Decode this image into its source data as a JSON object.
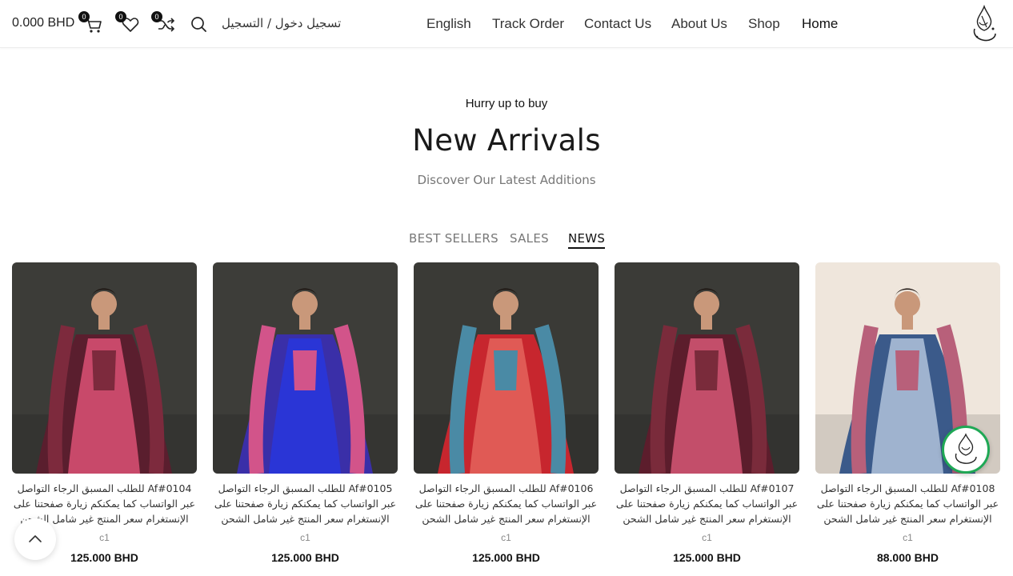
{
  "header": {
    "cart_total": "0.000 BHD",
    "cart_count": "0",
    "wishlist_count": "0",
    "compare_count": "0",
    "login_label": "تسجيل دخول / التسجيل",
    "nav": [
      "English",
      "Track Order",
      "Contact Us",
      "About Us",
      "Shop",
      "Home"
    ],
    "active_nav": "Home"
  },
  "hero": {
    "kicker": "Hurry up to buy",
    "title": "New Arrivals",
    "subtitle": "Discover Our Latest Additions"
  },
  "tabs": [
    "BEST SELLERS",
    "SALES",
    "NEWS"
  ],
  "active_tab": "NEWS",
  "products": [
    {
      "desc": "Af#0104 للطلب المسبق الرجاء التواصل عبر الواتساب كما يمكنكم زيارة صفحتنا على الإنستغرام سعر المنتج غير شامل الشحن",
      "category": "c1",
      "price": "125.000 BHD",
      "palette": [
        "#5a1e2e",
        "#c8496a",
        "#7d2a3d"
      ],
      "bg": "#3c3c38"
    },
    {
      "desc": "Af#0105 للطلب المسبق الرجاء التواصل عبر الواتساب  كما يمكنكم زيارة صفحتنا على الإنستغرام سعر المنتج غير شامل الشحن",
      "category": "c1",
      "price": "125.000 BHD",
      "palette": [
        "#3a2fa8",
        "#2a35d6",
        "#d2548a"
      ],
      "bg": "#3d3d39"
    },
    {
      "desc": "Af#0106 للطلب المسبق الرجاء التواصل عبر الواتساب كما يمكنكم زيارة صفحتنا على الإنستغرام سعر المنتج غير شامل الشحن",
      "category": "c1",
      "price": "125.000 BHD",
      "palette": [
        "#c7262e",
        "#e05a55",
        "#4a8aa5"
      ],
      "bg": "#3a3a36"
    },
    {
      "desc": "Af#0107 للطلب المسبق الرجاء التواصل عبر الواتساب كما يمكنكم زيارة صفحتنا على الإنستغرام سعر المنتج غير شامل الشحن",
      "category": "c1",
      "price": "125.000 BHD",
      "palette": [
        "#5c1d2c",
        "#c34e6a",
        "#7a2b3b"
      ],
      "bg": "#3b3b37"
    },
    {
      "desc": "Af#0108 للطلب المسبق الرجاء التواصل عبر الواتساب كما يمكنكم زيارة صفحتنا على الإنستغرام سعر المنتج غير شامل الشحن",
      "category": "c1",
      "price": "88.000 BHD",
      "palette": [
        "#3b5a8a",
        "#9fb3cf",
        "#b8607a"
      ],
      "bg": "#efe6dc"
    }
  ],
  "colors": {
    "accent": "#111111",
    "whatsapp": "#1fa855"
  },
  "icons": [
    "cart-icon",
    "heart-icon",
    "shuffle-icon",
    "search-icon",
    "logo-icon",
    "chevron-up-icon"
  ]
}
